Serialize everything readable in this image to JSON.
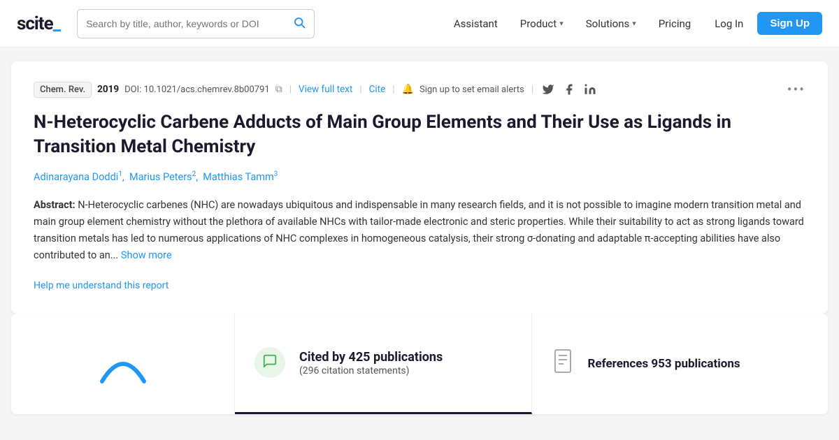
{
  "navbar": {
    "logo": "scite_",
    "search": {
      "placeholder": "Search by title, author, keywords or DOI"
    },
    "nav_items": [
      {
        "label": "Assistant",
        "has_dropdown": false
      },
      {
        "label": "Product",
        "has_dropdown": true
      },
      {
        "label": "Solutions",
        "has_dropdown": true
      },
      {
        "label": "Pricing",
        "has_dropdown": false
      }
    ],
    "login_label": "Log In",
    "signup_label": "Sign Up"
  },
  "paper": {
    "journal": "Chem. Rev.",
    "year": "2019",
    "doi": "DOI: 10.1021/acs.chemrev.8b00791",
    "view_full_text": "View full text",
    "cite": "Cite",
    "alert_text": "Sign up to set email alerts",
    "title": "N-Heterocyclic Carbene Adducts of Main Group Elements and Their Use as Ligands in Transition Metal Chemistry",
    "authors": [
      {
        "name": "Adinarayana Doddi",
        "superscript": "1"
      },
      {
        "name": "Marius Peters",
        "superscript": "2"
      },
      {
        "name": "Matthias Tamm",
        "superscript": "3"
      }
    ],
    "abstract_label": "Abstract:",
    "abstract_text": "N-Heterocyclic carbenes (NHC) are nowadays ubiquitous and indispensable in many research fields, and it is not possible to imagine modern transition metal and main group element chemistry without the plethora of available NHCs with tailor-made electronic and steric properties. While their suitability to act as strong ligands toward transition metals has led to numerous applications of NHC complexes in homogeneous catalysis, their strong σ-donating and adaptable π-accepting abilities have also contributed to an...",
    "show_more": "Show more",
    "help_link": "Help me understand this report"
  },
  "stats": {
    "cited_label": "Cited by 425 publications",
    "citation_statements": "(296 citation statements)",
    "refs_label": "References 953 publications"
  }
}
